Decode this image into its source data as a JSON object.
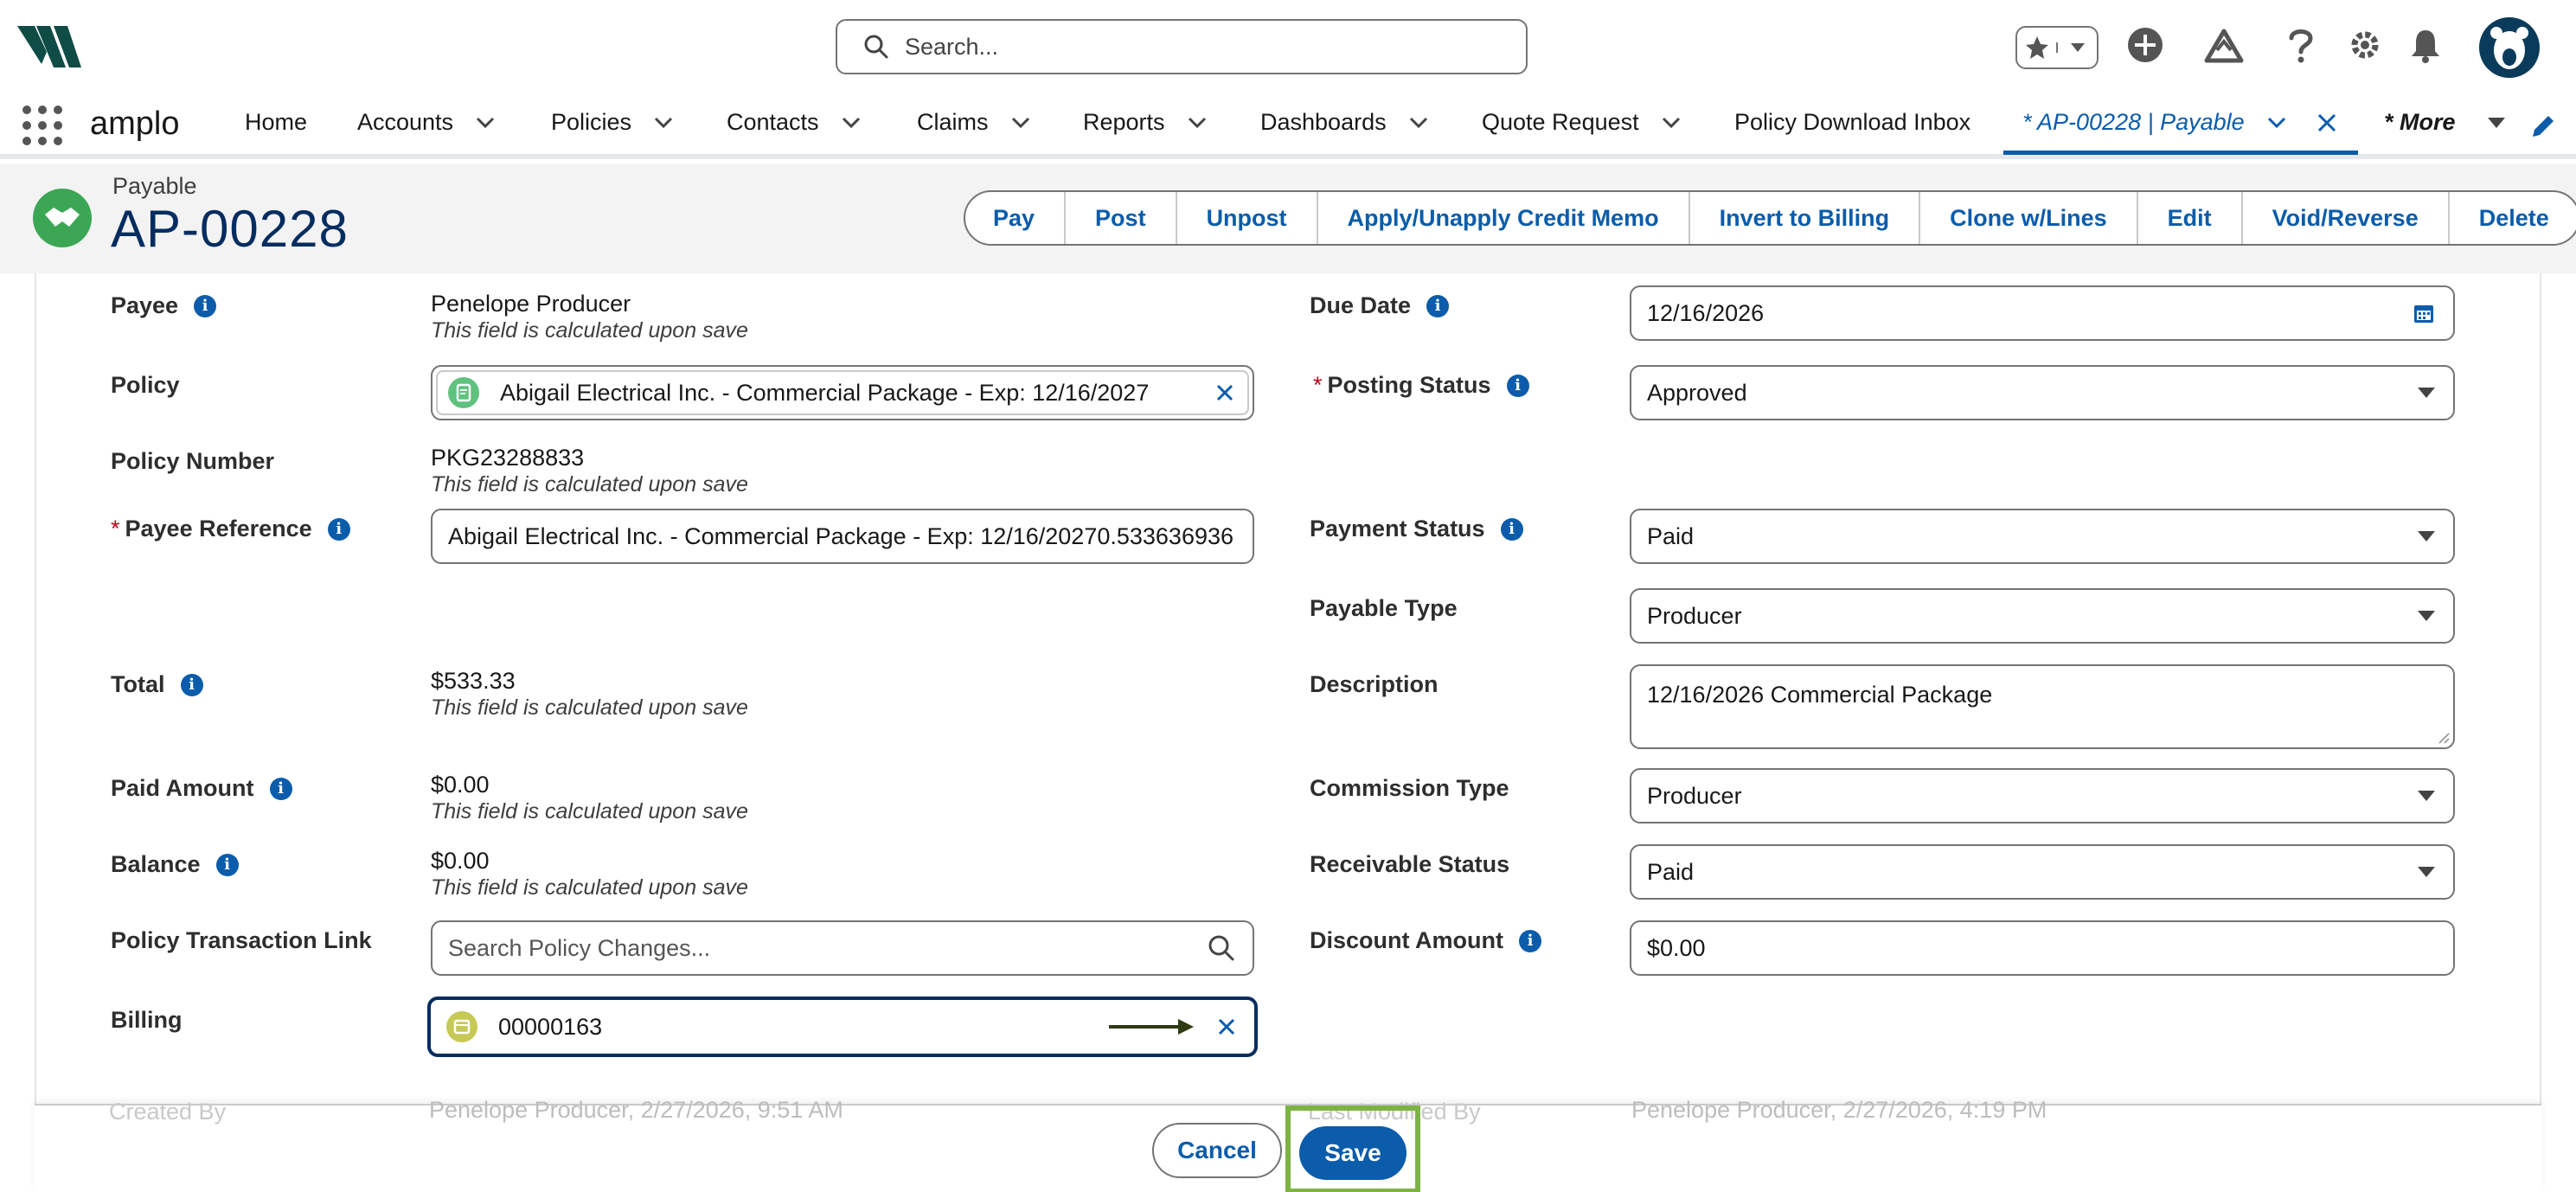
{
  "header": {
    "search_placeholder": "Search..."
  },
  "nav": {
    "app_name": "amplo",
    "items": [
      {
        "label": "Home",
        "dropdown": false
      },
      {
        "label": "Accounts",
        "dropdown": true
      },
      {
        "label": "Policies",
        "dropdown": true
      },
      {
        "label": "Contacts",
        "dropdown": true
      },
      {
        "label": "Claims",
        "dropdown": true
      },
      {
        "label": "Reports",
        "dropdown": true
      },
      {
        "label": "Dashboards",
        "dropdown": true
      },
      {
        "label": "Quote Request",
        "dropdown": true
      },
      {
        "label": "Policy Download Inbox",
        "dropdown": false
      }
    ],
    "active_tab": "* AP-00228 | Payable",
    "more": "* More"
  },
  "record": {
    "type": "Payable",
    "name": "AP-00228",
    "actions": [
      "Pay",
      "Post",
      "Unpost",
      "Apply/Unapply Credit Memo",
      "Invert to Billing",
      "Clone w/Lines",
      "Edit",
      "Void/Reverse",
      "Delete"
    ]
  },
  "form": {
    "calc_hint": "This field is calculated upon save",
    "payee": {
      "label": "Payee",
      "value": "Penelope Producer"
    },
    "policy": {
      "label": "Policy",
      "value": "Abigail Electrical Inc. - Commercial Package - Exp: 12/16/2027"
    },
    "policy_number": {
      "label": "Policy Number",
      "value": "PKG23288833"
    },
    "payee_reference": {
      "label": "Payee Reference",
      "value": "Abigail Electrical Inc. - Commercial Package - Exp: 12/16/20270.533636936"
    },
    "total": {
      "label": "Total",
      "value": "$533.33"
    },
    "paid_amount": {
      "label": "Paid Amount",
      "value": "$0.00"
    },
    "balance": {
      "label": "Balance",
      "value": "$0.00"
    },
    "policy_transaction_link": {
      "label": "Policy Transaction Link",
      "placeholder": "Search Policy Changes..."
    },
    "billing": {
      "label": "Billing",
      "value": "00000163"
    },
    "created_by": {
      "label": "Created By",
      "value": "Penelope Producer, 2/27/2026, 9:51 AM"
    },
    "due_date": {
      "label": "Due Date",
      "value": "12/16/2026"
    },
    "posting_status": {
      "label": "Posting Status",
      "value": "Approved"
    },
    "payment_status": {
      "label": "Payment Status",
      "value": "Paid"
    },
    "payable_type": {
      "label": "Payable Type",
      "value": "Producer"
    },
    "description": {
      "label": "Description",
      "value": "12/16/2026 Commercial Package"
    },
    "commission_type": {
      "label": "Commission Type",
      "value": "Producer"
    },
    "receivable_status": {
      "label": "Receivable Status",
      "value": "Paid"
    },
    "discount_amount": {
      "label": "Discount Amount",
      "value": "$0.00"
    },
    "last_modified_by": {
      "label": "Last Modified By",
      "value": "Penelope Producer, 2/27/2026, 4:19 PM"
    }
  },
  "footer": {
    "cancel": "Cancel",
    "save": "Save"
  },
  "colors": {
    "brand_blue": "#0b5cab",
    "navy": "#032d60",
    "highlight_green": "#7cb342"
  }
}
